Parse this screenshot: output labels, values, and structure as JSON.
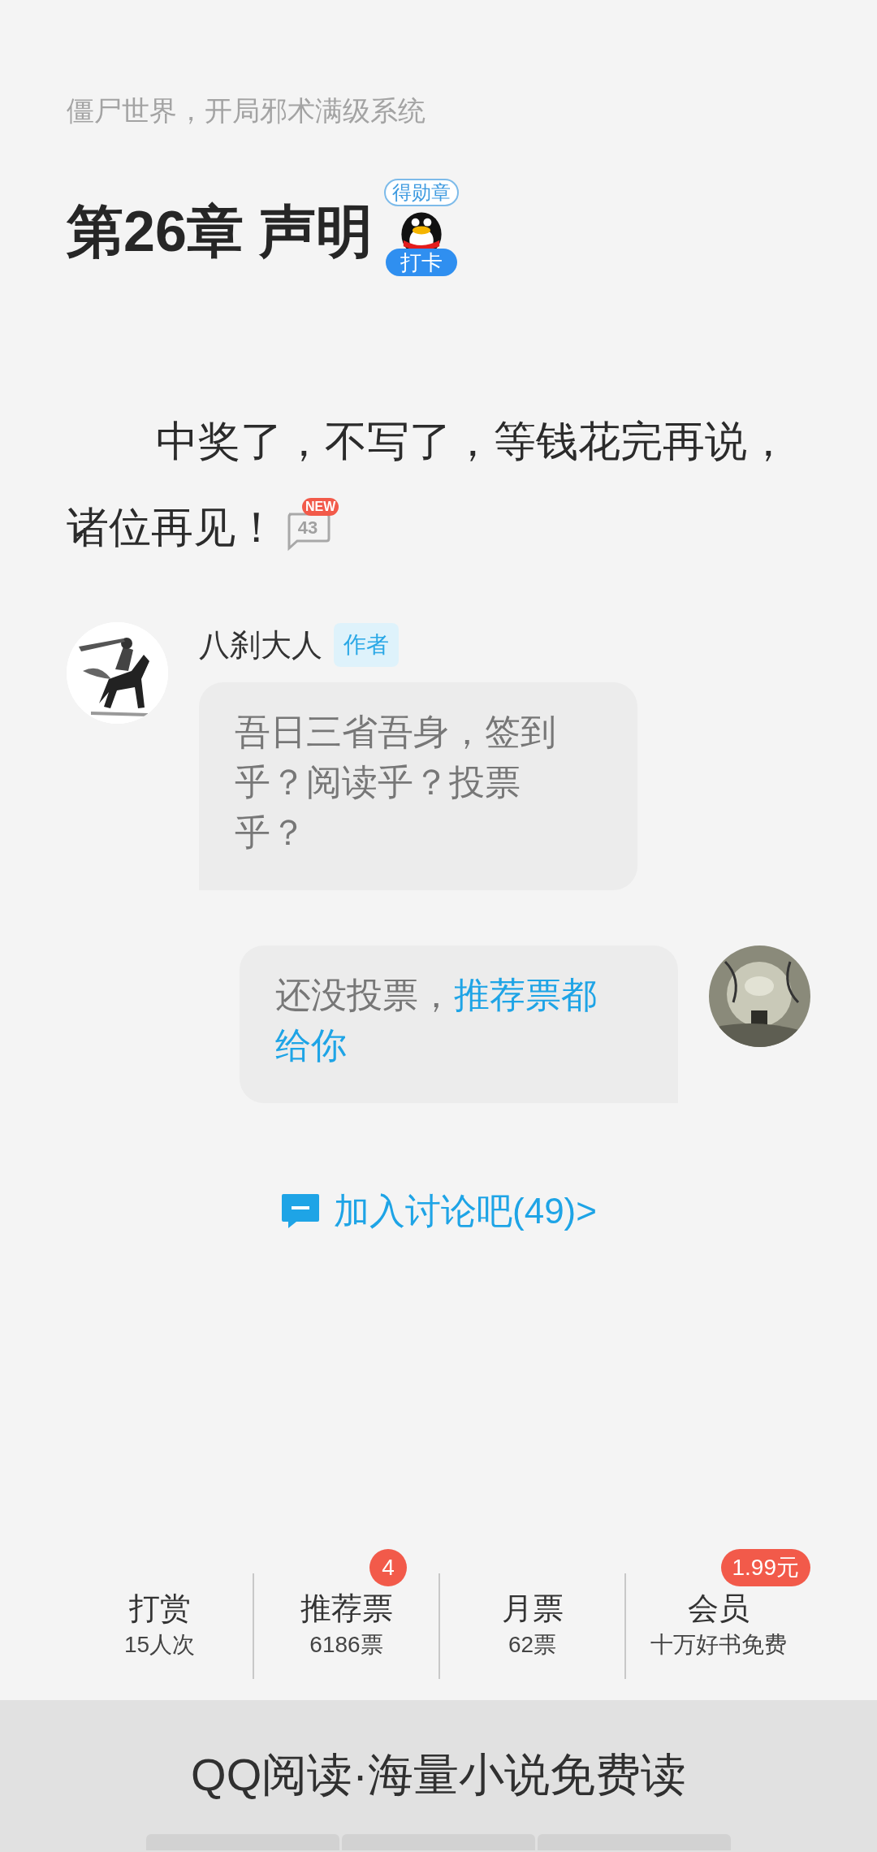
{
  "book_title": "僵尸世界，开局邪术满级系统",
  "chapter": {
    "title": "第26章 声明",
    "medal_label": "得勋章",
    "check_in": "打卡"
  },
  "paragraph": {
    "lines": [
      "中奖了，不写了，等钱花完再说，",
      "诸位再见！"
    ],
    "comment_count": "43",
    "new_badge": "NEW"
  },
  "comments": [
    {
      "kind": "author",
      "name": "八刹大人",
      "role": "作者",
      "segments": [
        {
          "kind": "text",
          "text": "吾日三省吾身，签到乎？阅读乎？投票乎？"
        }
      ]
    },
    {
      "kind": "reader",
      "segments": [
        {
          "kind": "text",
          "text": "还没投票，"
        },
        {
          "kind": "link",
          "text": "推荐票都给你"
        }
      ]
    }
  ],
  "discussion_link": "加入讨论吧(49)>",
  "stats": [
    {
      "label": "打赏",
      "sub": "15人次"
    },
    {
      "label": "推荐票",
      "sub": "6186票",
      "badge": "4"
    },
    {
      "label": "月票",
      "sub": "62票"
    },
    {
      "label": "会员",
      "sub": "十万好书免费",
      "badge": "1.99元"
    }
  ],
  "banner": "QQ阅读·海量小说免费读"
}
